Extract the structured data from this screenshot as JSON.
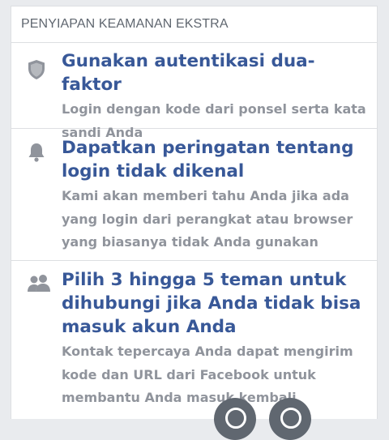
{
  "section": {
    "header": "PENYIAPAN KEAMANAN EKSTRA"
  },
  "items": [
    {
      "icon": "shield-icon",
      "title": "Gunakan autentikasi dua-faktor",
      "description": "Login dengan kode dari ponsel serta kata sandi Anda"
    },
    {
      "icon": "bell-icon",
      "title": "Dapatkan peringatan tentang login tidak dikenal",
      "description": "Kami akan memberi tahu Anda jika ada yang login dari perangkat atau browser yang biasanya tidak Anda gunakan"
    },
    {
      "icon": "friends-icon",
      "title": "Pilih 3 hingga 5 teman untuk dihubungi jika Anda tidak bisa masuk akun Anda",
      "description": "Kontak tepercaya Anda dapat mengirim kode dan URL dari Facebook untuk membantu Anda masuk kembali"
    }
  ],
  "colors": {
    "title": "#385898",
    "description": "#90949c",
    "icon": "#90949c",
    "background": "#e9ebee"
  }
}
